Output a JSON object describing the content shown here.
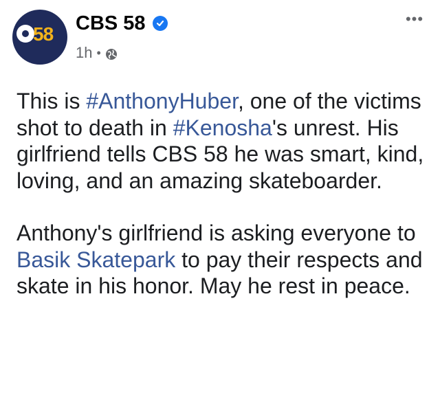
{
  "post": {
    "page_name": "CBS 58",
    "avatar_text": "58",
    "time_ago": "1h",
    "separator": "•",
    "more_label": "•••",
    "paragraph1": {
      "text_1": "This is ",
      "hashtag_1": "#AnthonyHuber",
      "text_2": ", one of the victims shot to death in ",
      "hashtag_2": "#Kenosha",
      "text_3": "'s unrest. His girlfriend tells CBS 58 he was smart, kind, loving, and an amazing skateboarder."
    },
    "paragraph2": {
      "text_1": "Anthony's girlfriend is asking everyone to ",
      "link_1": "Basik Skatepark",
      "text_2": " to pay their respects and skate in his honor. May he rest in peace."
    }
  },
  "colors": {
    "link": "#385898",
    "verified": "#1877f2",
    "meta": "#65676b",
    "avatar_bg": "#1f2b5b",
    "avatar_accent": "#f2b21b"
  },
  "icons": {
    "verified": "verified-badge-icon",
    "audience": "globe-icon",
    "more": "more-options-icon"
  }
}
